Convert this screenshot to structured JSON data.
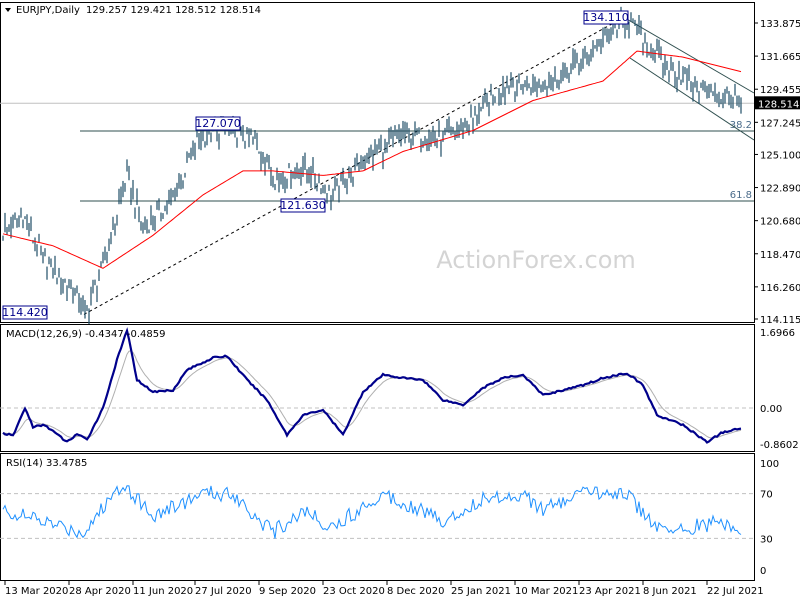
{
  "header": {
    "symbol": "EURJPY,Daily",
    "ohlc": "129.257 129.421 128.512 128.514"
  },
  "watermark": "ActionForex.com",
  "colors": {
    "bars": "#1f4e66",
    "ma": "#ff0000",
    "macd": "#00008b",
    "signal": "#b0b0b0",
    "rsi": "#1e90ff",
    "label_border": "#00008b"
  },
  "chart_data": [
    {
      "type": "ohlc",
      "title": "EURJPY,Daily",
      "ylim": [
        114.115,
        133.875
      ],
      "yticks": [
        "133.875",
        "131.665",
        "129.455",
        "127.245",
        "125.100",
        "122.890",
        "120.680",
        "118.470",
        "116.260",
        "114.115"
      ],
      "ytick_values": [
        133.875,
        131.665,
        129.455,
        127.245,
        125.1,
        122.89,
        120.68,
        118.47,
        116.26,
        114.115
      ],
      "current_price": "128.514",
      "bar_count": 370,
      "price_anchors": [
        [
          0,
          119.9
        ],
        [
          10,
          121.0
        ],
        [
          20,
          118.1
        ],
        [
          38,
          115.6
        ],
        [
          41,
          114.42
        ],
        [
          50,
          117.7
        ],
        [
          62,
          123.7
        ],
        [
          70,
          120.1
        ],
        [
          85,
          122.1
        ],
        [
          97,
          126.1
        ],
        [
          112,
          126.9
        ],
        [
          125,
          126.1
        ],
        [
          137,
          123.4
        ],
        [
          150,
          124.3
        ],
        [
          165,
          122.4
        ],
        [
          180,
          124.7
        ],
        [
          200,
          126.4
        ],
        [
          220,
          126.1
        ],
        [
          235,
          127.4
        ],
        [
          250,
          129.7
        ],
        [
          265,
          129.7
        ],
        [
          280,
          130.4
        ],
        [
          300,
          132.7
        ],
        [
          312,
          134.11
        ],
        [
          330,
          131.1
        ],
        [
          350,
          129.4
        ],
        [
          370,
          128.5
        ]
      ],
      "ma_anchors": [
        [
          0,
          119.8
        ],
        [
          25,
          119.0
        ],
        [
          50,
          117.5
        ],
        [
          75,
          119.7
        ],
        [
          100,
          122.4
        ],
        [
          120,
          124.0
        ],
        [
          135,
          124.0
        ],
        [
          160,
          123.7
        ],
        [
          180,
          124.0
        ],
        [
          200,
          125.3
        ],
        [
          235,
          126.7
        ],
        [
          265,
          128.7
        ],
        [
          300,
          130.0
        ],
        [
          317,
          132.0
        ],
        [
          340,
          131.6
        ],
        [
          370,
          130.6
        ]
      ],
      "labels": [
        "114.420",
        "127.070",
        "121.630",
        "134.110"
      ],
      "label_values": [
        114.42,
        127.07,
        121.63,
        134.11
      ],
      "fib_labels": [
        "38.2",
        "61.8"
      ],
      "fib_values": [
        126.67,
        122.0
      ],
      "x_labels": [
        "13 Mar 2020",
        "28 Apr 2020",
        "11 Jun 2020",
        "27 Jul 2020",
        "9 Sep 2020",
        "23 Oct 2020",
        "8 Dec 2020",
        "25 Jan 2021",
        "10 Mar 2021",
        "23 Apr 2021",
        "8 Jun 2021",
        "22 Jul 2021"
      ],
      "x_label_bars": [
        1,
        33,
        65,
        96,
        128,
        160,
        192,
        224,
        256,
        288,
        320,
        352
      ]
    },
    {
      "type": "line",
      "title": "MACD(12,26,9) -0.4347 -0.4859",
      "ylim": [
        -0.8602,
        1.6966
      ],
      "yticks": [
        "1.6966",
        "0.00",
        "-0.8602"
      ],
      "ytick_values": [
        1.6966,
        0,
        -0.8602
      ],
      "macd_anchors": [
        [
          0,
          -0.56
        ],
        [
          5,
          -0.62
        ],
        [
          11,
          0.0
        ],
        [
          15,
          -0.42
        ],
        [
          21,
          -0.38
        ],
        [
          32,
          -0.76
        ],
        [
          37,
          -0.58
        ],
        [
          42,
          -0.71
        ],
        [
          50,
          0.0
        ],
        [
          57,
          1.07
        ],
        [
          62,
          1.74
        ],
        [
          67,
          0.63
        ],
        [
          75,
          0.36
        ],
        [
          85,
          0.4
        ],
        [
          92,
          0.85
        ],
        [
          105,
          1.12
        ],
        [
          112,
          1.16
        ],
        [
          122,
          0.63
        ],
        [
          132,
          0.18
        ],
        [
          142,
          -0.6
        ],
        [
          150,
          -0.16
        ],
        [
          160,
          -0.04
        ],
        [
          170,
          -0.6
        ],
        [
          180,
          0.36
        ],
        [
          190,
          0.74
        ],
        [
          200,
          0.67
        ],
        [
          210,
          0.63
        ],
        [
          220,
          0.18
        ],
        [
          230,
          0.07
        ],
        [
          240,
          0.45
        ],
        [
          250,
          0.67
        ],
        [
          260,
          0.74
        ],
        [
          270,
          0.29
        ],
        [
          280,
          0.4
        ],
        [
          290,
          0.51
        ],
        [
          300,
          0.67
        ],
        [
          312,
          0.78
        ],
        [
          320,
          0.51
        ],
        [
          327,
          -0.16
        ],
        [
          340,
          -0.38
        ],
        [
          352,
          -0.76
        ],
        [
          360,
          -0.54
        ],
        [
          370,
          -0.45
        ]
      ]
    },
    {
      "type": "line",
      "title": "RSI(14) 33.4785",
      "ylim": [
        0,
        100
      ],
      "yticks": [
        "100",
        "70",
        "30",
        "0"
      ],
      "ytick_values": [
        100,
        70,
        30,
        0
      ],
      "rsi_anchors": [
        [
          0,
          55
        ],
        [
          20,
          45
        ],
        [
          40,
          35
        ],
        [
          60,
          80
        ],
        [
          75,
          50
        ],
        [
          100,
          70
        ],
        [
          115,
          70
        ],
        [
          135,
          35
        ],
        [
          150,
          55
        ],
        [
          165,
          40
        ],
        [
          190,
          70
        ],
        [
          210,
          55
        ],
        [
          220,
          45
        ],
        [
          240,
          65
        ],
        [
          260,
          70
        ],
        [
          270,
          55
        ],
        [
          290,
          70
        ],
        [
          310,
          72
        ],
        [
          330,
          35
        ],
        [
          350,
          42
        ],
        [
          360,
          45
        ],
        [
          370,
          33.5
        ]
      ]
    }
  ]
}
